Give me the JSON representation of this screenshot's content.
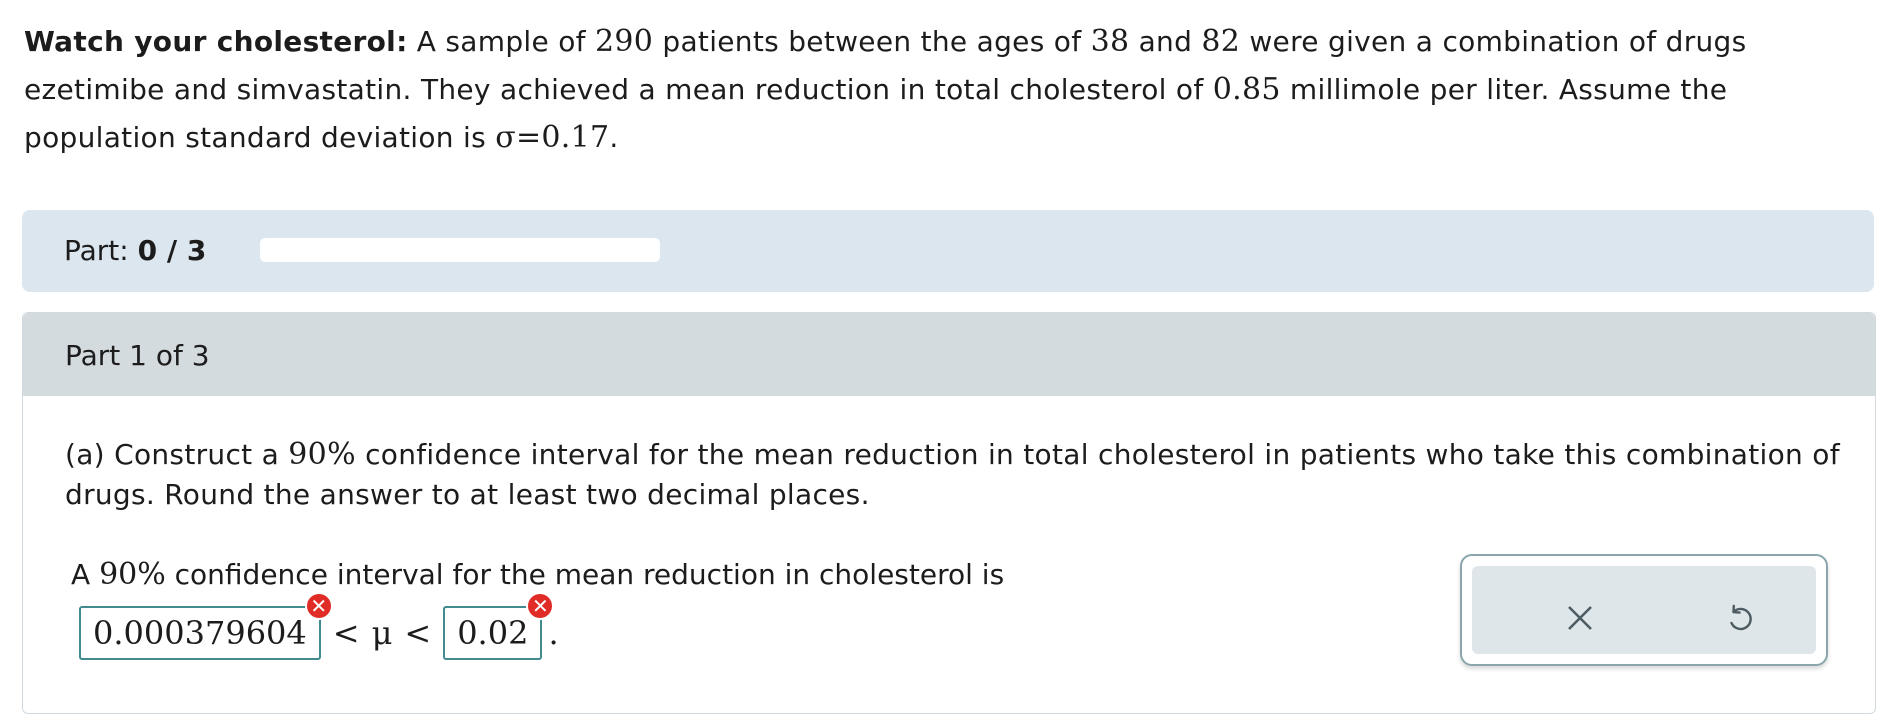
{
  "problem": {
    "title": "Watch your cholesterol:",
    "t1": " A sample of ",
    "n": "290",
    "t2": " patients between the ages of ",
    "age_min": "38",
    "t3": " and ",
    "age_max": "82",
    "t4": " were given a combination of drugs ezetimibe and simvastatin. They achieved a mean reduction in total cholesterol of ",
    "mean": "0.85",
    "t5": " millimole per liter. Assume the population standard deviation is ",
    "sigma": "σ=0.17",
    "t6": "."
  },
  "progress": {
    "label": "Part:",
    "value": "0 / 3",
    "fraction": 0
  },
  "part": {
    "header": "Part 1 of 3",
    "q1": "(a) Construct a ",
    "conf": "90%",
    "q2": " confidence interval for the mean reduction in total cholesterol in patients who take this combination of drugs. Round the answer to at least two decimal places."
  },
  "ci": {
    "t1": "A ",
    "conf": "90%",
    "t2": " confidence interval for the mean reduction in cholesterol is",
    "lower_value": "0.000379604",
    "upper_value": "0.02",
    "lt1": "<",
    "mu": "μ",
    "lt2": "<",
    "period": ".",
    "error_symbol": "✕"
  },
  "toolbar": {
    "clear_icon": "close-icon",
    "reset_icon": "undo-icon"
  },
  "colors": {
    "partbar_bg": "#dbe6ef",
    "part_header_bg": "#d3dbdf",
    "input_border": "#3f8b8f",
    "error": "#e02b27"
  }
}
